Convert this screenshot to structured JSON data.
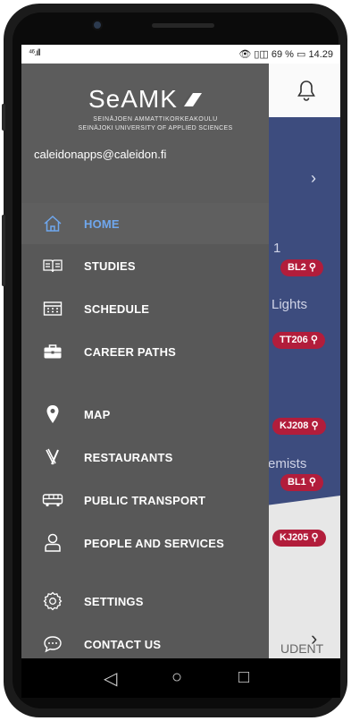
{
  "status": {
    "left": "⁴⁶.ıll",
    "right": "👁 ▯◫ 69 % ▭ 14.29"
  },
  "background": {
    "texts": [
      "1",
      "Lights",
      "emists",
      "UDENT UN"
    ],
    "badges": [
      "BL2 ⚲",
      "TT206 ⚲",
      "KJ208 ⚲",
      "BL1 ⚲",
      "KJ205 ⚲"
    ]
  },
  "drawer": {
    "logo": "SeAMK",
    "logo_sub1": "SEINÄJOEN AMMATTIKORKEAKOULU",
    "logo_sub2": "SEINÄJOKI UNIVERSITY OF APPLIED SCIENCES",
    "email": "caleidonapps@caleidon.fi",
    "items": [
      {
        "label": "HOME",
        "icon": "home-icon"
      },
      {
        "label": "STUDIES",
        "icon": "book-icon"
      },
      {
        "label": "SCHEDULE",
        "icon": "calendar-icon"
      },
      {
        "label": "CAREER PATHS",
        "icon": "briefcase-icon"
      },
      {
        "label": "MAP",
        "icon": "map-pin-icon"
      },
      {
        "label": "RESTAURANTS",
        "icon": "cutlery-icon"
      },
      {
        "label": "PUBLIC TRANSPORT",
        "icon": "bus-icon"
      },
      {
        "label": "PEOPLE AND SERVICES",
        "icon": "person-icon"
      },
      {
        "label": "SETTINGS",
        "icon": "gear-icon"
      },
      {
        "label": "CONTACT US",
        "icon": "chat-icon"
      }
    ]
  },
  "nav": {
    "back": "◁",
    "home": "○",
    "recents": "□"
  },
  "colors": {
    "active": "#6fa7ee",
    "drawer": "#585858",
    "accent_bg": "#3d4c7e",
    "badge": "#b21d3b"
  }
}
